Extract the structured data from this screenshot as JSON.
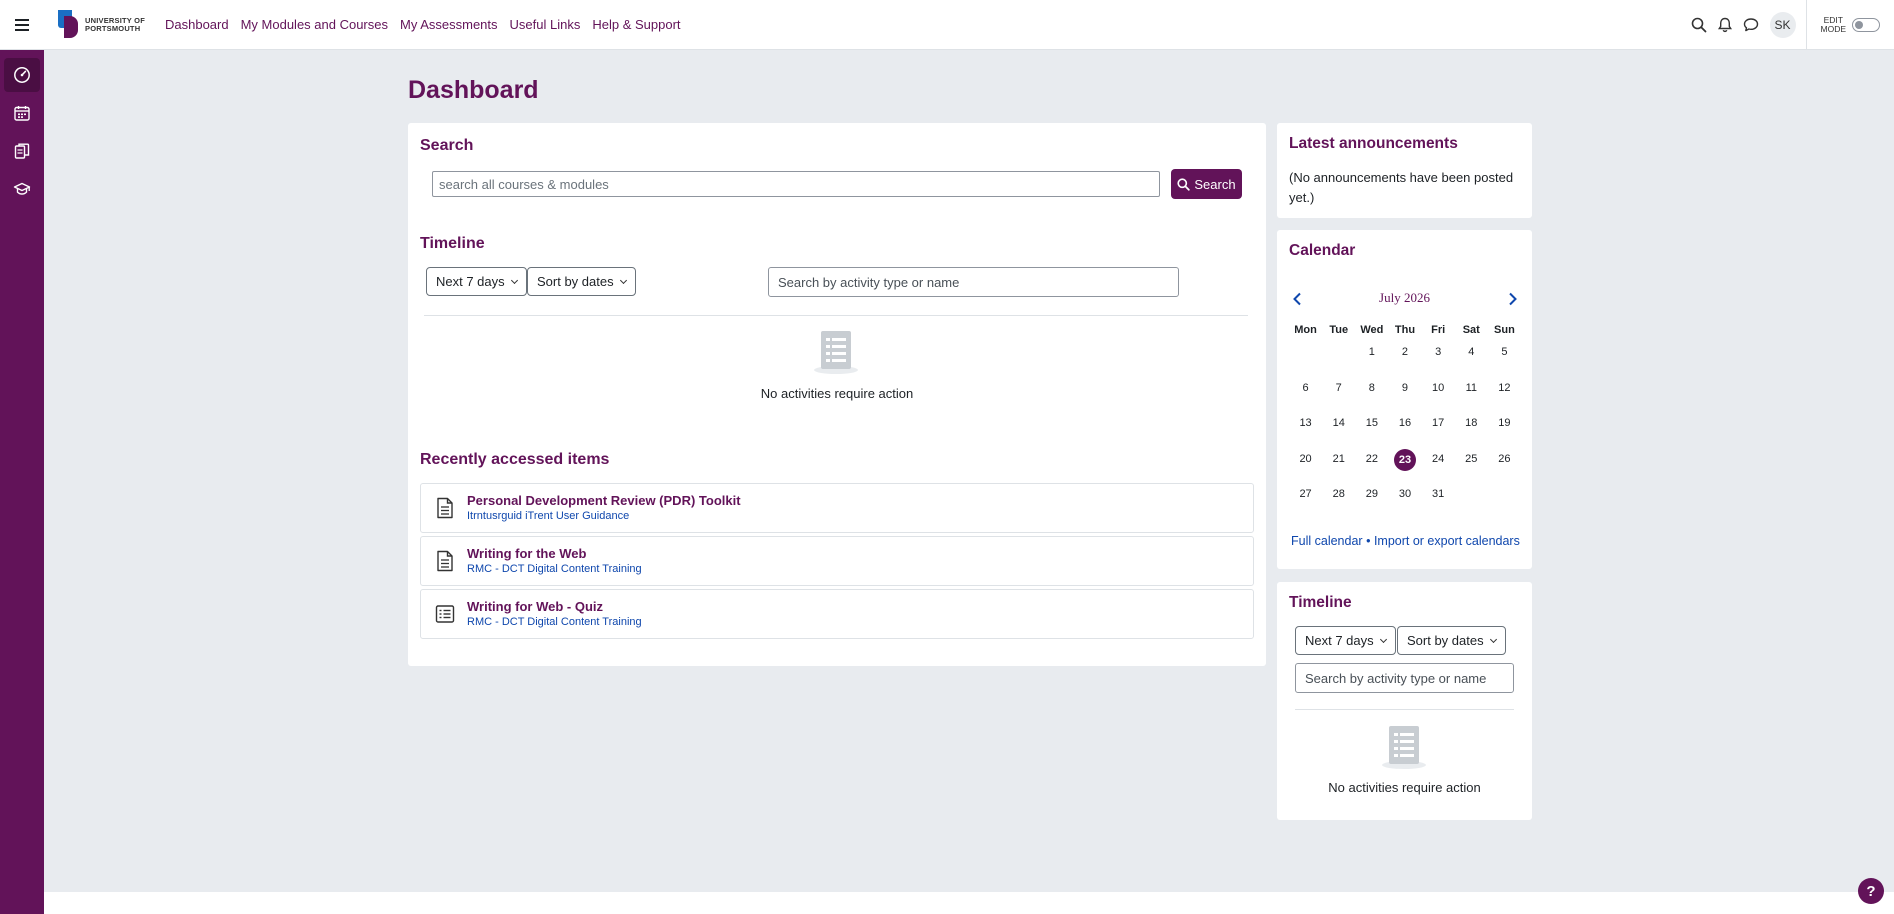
{
  "nav": {
    "logo_line1": "UNIVERSITY OF",
    "logo_line2": "PORTSMOUTH",
    "links": [
      "Dashboard",
      "My Modules and Courses",
      "My Assessments",
      "Useful Links",
      "Help & Support"
    ],
    "avatar_initials": "SK",
    "edit_mode_line1": "EDIT",
    "edit_mode_line2": "MODE"
  },
  "page": {
    "title": "Dashboard"
  },
  "search": {
    "title": "Search",
    "placeholder": "search all courses & modules",
    "button_label": "Search"
  },
  "timeline": {
    "title": "Timeline",
    "range_label": "Next 7 days",
    "sort_label": "Sort by dates",
    "filter_placeholder": "Search by activity type or name",
    "empty_text": "No activities require action"
  },
  "recent": {
    "title": "Recently accessed items",
    "items": [
      {
        "name": "Personal Development Review (PDR) Toolkit",
        "course": "Itrntusrguid iTrent User Guidance",
        "icon": "page-icon"
      },
      {
        "name": "Writing for the Web",
        "course": "RMC - DCT Digital Content Training",
        "icon": "page-icon"
      },
      {
        "name": "Writing for Web - Quiz",
        "course": "RMC - DCT Digital Content Training",
        "icon": "quiz-icon"
      }
    ]
  },
  "announcements": {
    "title": "Latest announcements",
    "text": "(No announcements have been posted yet.)"
  },
  "calendar": {
    "title": "Calendar",
    "month": "July 2026",
    "weekdays": [
      "Mon",
      "Tue",
      "Wed",
      "Thu",
      "Fri",
      "Sat",
      "Sun"
    ],
    "days": [
      "",
      "",
      "1",
      "2",
      "3",
      "4",
      "5",
      "6",
      "7",
      "8",
      "9",
      "10",
      "11",
      "12",
      "13",
      "14",
      "15",
      "16",
      "17",
      "18",
      "19",
      "20",
      "21",
      "22",
      "23",
      "24",
      "25",
      "26",
      "27",
      "28",
      "29",
      "30",
      "31"
    ],
    "today": "23",
    "link_full": "Full calendar",
    "link_separator": "•",
    "link_import": "Import or export calendars"
  },
  "side_timeline": {
    "title": "Timeline",
    "range_label": "Next 7 days",
    "sort_label": "Sort by dates",
    "filter_placeholder": "Search by activity type or name",
    "empty_text": "No activities require action"
  },
  "help": {
    "label": "?"
  },
  "colors": {
    "brand": "#621359",
    "link": "#0f47ad",
    "background": "#e8ebef"
  }
}
